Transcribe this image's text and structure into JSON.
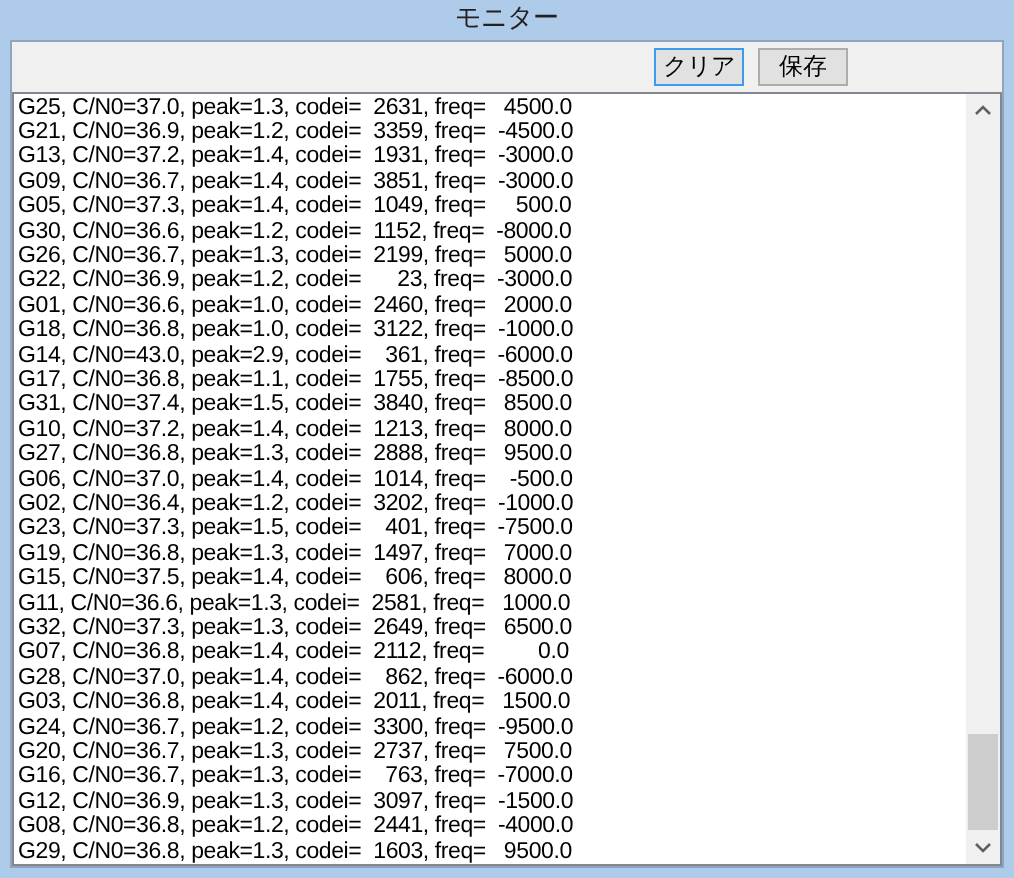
{
  "window": {
    "title": "モニター"
  },
  "buttons": [
    {
      "label": "クリア",
      "focused": true
    },
    {
      "label": "保存",
      "focused": false
    }
  ],
  "log_lines": [
    "G25, C/N0=37.0, peak=1.3, codei=  2631, freq=   4500.0",
    "G21, C/N0=36.9, peak=1.2, codei=  3359, freq=  -4500.0",
    "G13, C/N0=37.2, peak=1.4, codei=  1931, freq=  -3000.0",
    "G09, C/N0=36.7, peak=1.4, codei=  3851, freq=  -3000.0",
    "G05, C/N0=37.3, peak=1.4, codei=  1049, freq=     500.0",
    "G30, C/N0=36.6, peak=1.2, codei=  1152, freq=  -8000.0",
    "G26, C/N0=36.7, peak=1.3, codei=  2199, freq=   5000.0",
    "G22, C/N0=36.9, peak=1.2, codei=      23, freq=  -3000.0",
    "G01, C/N0=36.6, peak=1.0, codei=  2460, freq=   2000.0",
    "G18, C/N0=36.8, peak=1.0, codei=  3122, freq=  -1000.0",
    "G14, C/N0=43.0, peak=2.9, codei=    361, freq=  -6000.0",
    "G17, C/N0=36.8, peak=1.1, codei=  1755, freq=  -8500.0",
    "G31, C/N0=37.4, peak=1.5, codei=  3840, freq=   8500.0",
    "G10, C/N0=37.2, peak=1.4, codei=  1213, freq=   8000.0",
    "G27, C/N0=36.8, peak=1.3, codei=  2888, freq=   9500.0",
    "G06, C/N0=37.0, peak=1.4, codei=  1014, freq=    -500.0",
    "G02, C/N0=36.4, peak=1.2, codei=  3202, freq=  -1000.0",
    "G23, C/N0=37.3, peak=1.5, codei=    401, freq=  -7500.0",
    "G19, C/N0=36.8, peak=1.3, codei=  1497, freq=   7000.0",
    "G15, C/N0=37.5, peak=1.4, codei=    606, freq=   8000.0",
    "G11, C/N0=36.6, peak=1.3, codei=  2581, freq=   1000.0",
    "G32, C/N0=37.3, peak=1.3, codei=  2649, freq=   6500.0",
    "G07, C/N0=36.8, peak=1.4, codei=  2112, freq=         0.0",
    "G28, C/N0=37.0, peak=1.4, codei=    862, freq=  -6000.0",
    "G03, C/N0=36.8, peak=1.4, codei=  2011, freq=   1500.0",
    "G24, C/N0=36.7, peak=1.2, codei=  3300, freq=  -9500.0",
    "G20, C/N0=36.7, peak=1.3, codei=  2737, freq=   7500.0",
    "G16, C/N0=36.7, peak=1.3, codei=    763, freq=  -7000.0",
    "G12, C/N0=36.9, peak=1.3, codei=  3097, freq=  -1500.0",
    "G08, C/N0=36.8, peak=1.2, codei=  2441, freq=  -4000.0",
    "G29, C/N0=36.8, peak=1.3, codei=  1603, freq=   9500.0"
  ]
}
